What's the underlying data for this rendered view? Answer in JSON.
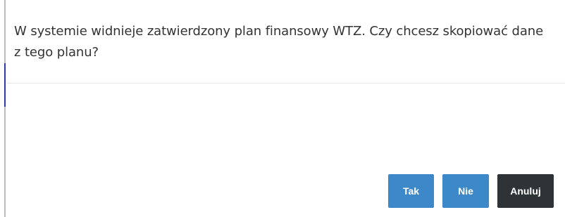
{
  "dialog": {
    "message": "W systemie widnieje zatwierdzony plan finansowy WTZ. Czy chcesz skopiować dane z tego planu?",
    "buttons": {
      "yes_label": "Tak",
      "no_label": "Nie",
      "cancel_label": "Anuluj"
    }
  },
  "colors": {
    "primary_button": "#3d88c8",
    "dark_button": "#2e3338",
    "text": "#333333"
  }
}
